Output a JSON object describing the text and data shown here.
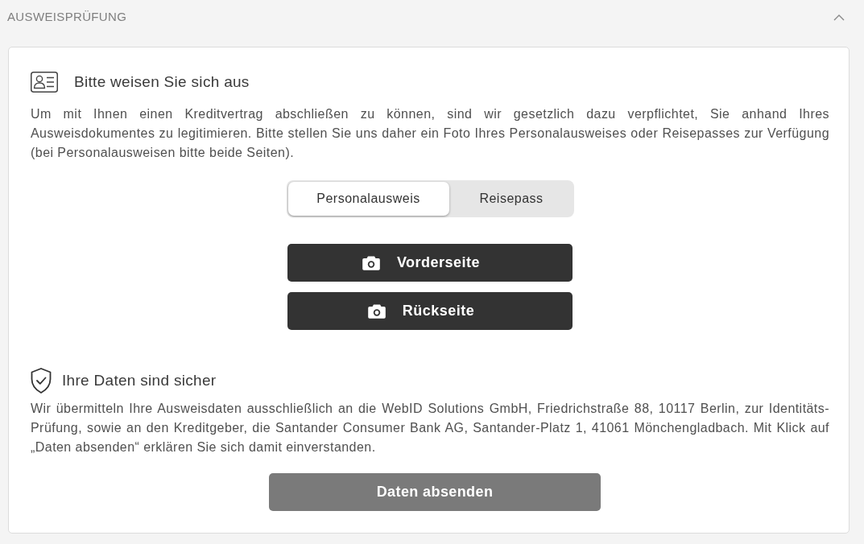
{
  "section": {
    "title": "AUSWEISPRÜFUNG",
    "expanded": true
  },
  "identify": {
    "title": "Bitte weisen Sie sich aus",
    "text": "Um mit Ihnen einen Kreditvertrag abschließen zu können, sind wir gesetzlich dazu verpflichtet, Sie anhand Ihres Ausweisdokumentes zu legitimieren. Bitte stellen Sie uns daher ein Foto Ihres Personalausweises oder Reisepasses zur Verfügung (bei Personalausweisen bitte beide Seiten)."
  },
  "document_tabs": [
    {
      "label": "Personalausweis",
      "selected": true
    },
    {
      "label": "Reisepass",
      "selected": false
    }
  ],
  "upload_buttons": [
    {
      "label": "Vorderseite"
    },
    {
      "label": "Rückseite"
    }
  ],
  "privacy": {
    "title": "Ihre Daten sind sicher",
    "text": "Wir übermitteln Ihre Ausweisdaten ausschließlich an die WebID Solutions GmbH, Friedrichstraße 88, 10117 Berlin, zur Identitäts-Prüfung, sowie an den Kreditgeber, die Santander Consumer Bank AG, Santander-Platz 1, 41061 Mönchengladbach. Mit Klick auf „Daten absenden“ erklären Sie sich damit einverstanden."
  },
  "submit_button": {
    "label": "Daten absenden",
    "disabled": true
  }
}
